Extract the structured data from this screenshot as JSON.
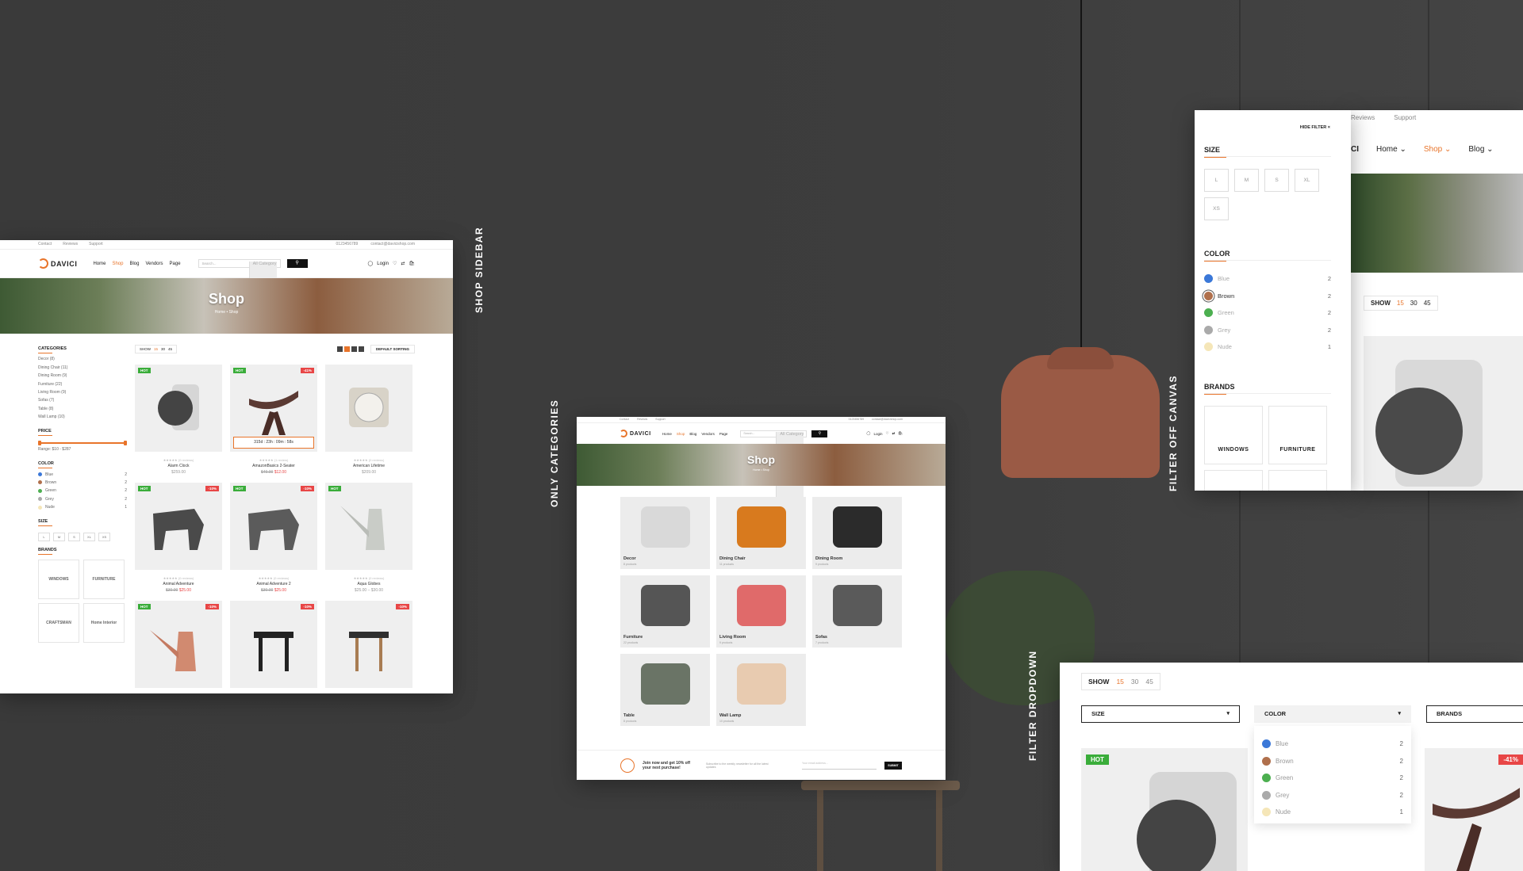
{
  "colors": {
    "accent": "#e8742a",
    "hot": "#3aad3a",
    "sale": "#e84646",
    "background": "#3b3b3b"
  },
  "section_labels": {
    "shop_sidebar": "SHOP SIDEBAR",
    "only_categories": "ONLY CATEGORIES",
    "filter_off_canvas": "FILTER OFF CANVAS",
    "filter_dropdown": "FILTER DROPDOWN"
  },
  "site": {
    "topbar": [
      "Contact",
      "Reviews",
      "Support"
    ],
    "phone": "0123456789",
    "email": "contact@davicishop.com",
    "logo": "DAVICI",
    "menu": [
      "Home",
      "Shop",
      "Blog",
      "Vendors",
      "Page"
    ],
    "search_placeholder": "Search...",
    "all_category": "All Category",
    "login": "Login"
  },
  "hero": {
    "title": "Shop",
    "breadcrumb": "Home • Shop"
  },
  "sidebar": {
    "categories_title": "CATEGORIES",
    "categories": [
      {
        "label": "Decor (8)"
      },
      {
        "label": "Dining Chair (11)"
      },
      {
        "label": "Dining Room (9)"
      },
      {
        "label": "Furniture (22)"
      },
      {
        "label": "Living Room (9)"
      },
      {
        "label": "Sofas (7)"
      },
      {
        "label": "Table (8)"
      },
      {
        "label": "Wall Lamp (10)"
      }
    ],
    "price_title": "PRICE",
    "price_range": "Range: $10 - $287",
    "color_title": "COLOR",
    "colors": [
      {
        "name": "Blue",
        "count": "2",
        "hex": "#3b78d8"
      },
      {
        "name": "Brown",
        "count": "2",
        "hex": "#b0704c"
      },
      {
        "name": "Green",
        "count": "2",
        "hex": "#4caf50"
      },
      {
        "name": "Grey",
        "count": "2",
        "hex": "#aaaaaa"
      },
      {
        "name": "Nude",
        "count": "1",
        "hex": "#f5e6b8"
      }
    ],
    "size_title": "SIZE",
    "sizes": [
      "L",
      "M",
      "S",
      "XL",
      "XS"
    ],
    "brands_title": "BRANDS",
    "brands": [
      "WINDOWS",
      "FURNITURE",
      "CRAFTSMAN",
      "Home Interior"
    ]
  },
  "toolbar": {
    "show_label": "SHOW",
    "show_opts": [
      "15",
      "30",
      "45"
    ],
    "sort": "DEFAULT SORTING"
  },
  "products": [
    {
      "badge_hot": "HOT",
      "badge_sale": "",
      "reviews": "(0 reviews)",
      "name": "Alarm Clock",
      "old": "",
      "price": "$259.00"
    },
    {
      "badge_hot": "HOT",
      "badge_sale": "-41%",
      "reviews": "(1 review)",
      "name": "AmazonBasics 2-Seater",
      "old": "$49.00",
      "price": "$12.00",
      "countdown": "315d : 23h : 09m : 58s"
    },
    {
      "badge_hot": "",
      "badge_sale": "",
      "reviews": "(0 reviews)",
      "name": "American Lifetime",
      "old": "",
      "price": "$209.00"
    },
    {
      "badge_hot": "HOT",
      "badge_sale": "-10%",
      "reviews": "(0 reviews)",
      "name": "Animal Adventure",
      "old": "$30.00",
      "price": "$25.00"
    },
    {
      "badge_hot": "HOT",
      "badge_sale": "-10%",
      "reviews": "(0 reviews)",
      "name": "Animal Adventure 2",
      "old": "$30.00",
      "price": "$25.00"
    },
    {
      "badge_hot": "HOT",
      "badge_sale": "",
      "reviews": "(0 reviews)",
      "name": "Aqua Globes",
      "old": "",
      "price": "$25.00 – $30.00"
    },
    {
      "badge_hot": "HOT",
      "badge_sale": "-10%",
      "reviews": "",
      "name": "",
      "old": "",
      "price": ""
    },
    {
      "badge_hot": "",
      "badge_sale": "-10%",
      "reviews": "",
      "name": "",
      "old": "",
      "price": ""
    },
    {
      "badge_hot": "",
      "badge_sale": "-10%",
      "reviews": "",
      "name": "",
      "old": "",
      "price": ""
    }
  ],
  "categories_page": [
    {
      "name": "Decor",
      "count": "8 products",
      "color": "#d9d9d9"
    },
    {
      "name": "Dining Chair",
      "count": "11 products",
      "color": "#d87a1e"
    },
    {
      "name": "Dining Room",
      "count": "9 products",
      "color": "#2b2b2b"
    },
    {
      "name": "Furniture",
      "count": "22 products",
      "color": "#555555"
    },
    {
      "name": "Living Room",
      "count": "9 products",
      "color": "#e06a6a"
    },
    {
      "name": "Sofas",
      "count": "7 products",
      "color": "#5a5a5a"
    },
    {
      "name": "Table",
      "count": "8 products",
      "color": "#6a7466"
    },
    {
      "name": "Wall Lamp",
      "count": "10 products",
      "color": "#e8cbb0"
    }
  ],
  "newsletter": {
    "text": "Join now and get 10% off your next purchase!",
    "sub": "Subscribe to the weekly newsletter for all the latest updates",
    "placeholder": "Your email address...",
    "button": "SUBMIT"
  },
  "offcanvas": {
    "hide": "HIDE FILTER ×",
    "size_title": "SIZE",
    "color_title": "COLOR",
    "brands_title": "BRANDS",
    "brand_labels": [
      "WINDOWS",
      "FURNITURE"
    ],
    "bg_nav": [
      "Reviews",
      "Support"
    ],
    "bg_menu": [
      "Home ⌄",
      "Shop ⌄",
      "Blog ⌄"
    ]
  },
  "dropdown": {
    "size": "SIZE",
    "color": "COLOR",
    "brands": "BRANDS",
    "caret": "▾",
    "hot": "HOT",
    "sale": "-41%"
  }
}
